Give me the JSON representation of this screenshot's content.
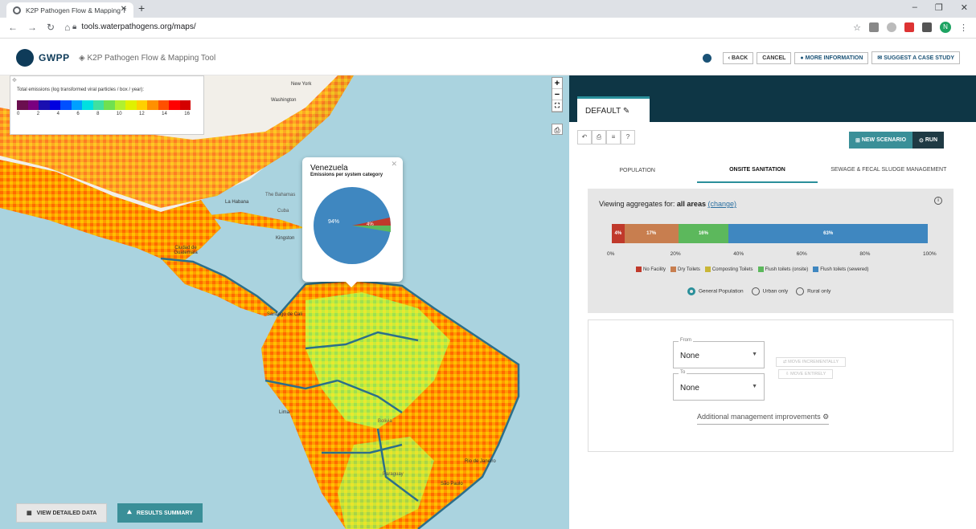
{
  "browser": {
    "tab_title": "K2P Pathogen Flow & Mapping T",
    "url": "tools.waterpathogens.org/maps/",
    "profile_initial": "N"
  },
  "header": {
    "logo_text": "GWPP",
    "app_title": "K2P Pathogen Flow & Mapping Tool",
    "buttons": {
      "back": "BACK",
      "cancel": "CANCEL",
      "more_info": "MORE INFORMATION",
      "suggest": "SUGGEST A CASE STUDY"
    }
  },
  "map": {
    "legend_title": "Total emissions (log transformed viral particles / box / year):",
    "legend_ticks": [
      "0",
      "2",
      "4",
      "6",
      "8",
      "10",
      "12",
      "14",
      "16"
    ],
    "legend_colors": [
      "#6b0f4f",
      "#7a0080",
      "#1a0fb0",
      "#0000e0",
      "#0050ff",
      "#00a0ff",
      "#00e0e0",
      "#40e0a0",
      "#70e050",
      "#b0f030",
      "#e0f000",
      "#ffd000",
      "#ff9000",
      "#ff5000",
      "#ff0000",
      "#d40000"
    ],
    "place_labels": [
      "New York",
      "Washington",
      "The Bahamas",
      "La Habana",
      "Cuba",
      "Kingston",
      "Ciudad de Guatemala",
      "Santiago de Cali",
      "Lima",
      "Bolivia",
      "Paraguay",
      "Rio de Janeiro",
      "São Paulo"
    ],
    "popup": {
      "title": "Venezuela",
      "subtitle": "Emissions per system category",
      "main_label": "94%",
      "small_label": "4%"
    },
    "buttons": {
      "view_data": "VIEW DETAILED DATA",
      "results": "RESULTS SUMMARY"
    }
  },
  "panel": {
    "tab_label": "DEFAULT",
    "new_scenario": "NEW SCENARIO",
    "run": "RUN",
    "tabs": [
      "POPULATION",
      "ONSITE SANITATION",
      "SEWAGE & FECAL SLUDGE MANAGEMENT"
    ],
    "viewing_prefix": "Viewing aggregates for:",
    "viewing_area": "all areas",
    "change_link": "(change)",
    "axis_ticks": [
      "0%",
      "20%",
      "40%",
      "60%",
      "80%",
      "100%"
    ],
    "categories": [
      {
        "name": "No Facility",
        "color": "#c0392b",
        "pct": 4,
        "label": "4%"
      },
      {
        "name": "Dry Toilets",
        "color": "#c87e4f",
        "pct": 17,
        "label": "17%"
      },
      {
        "name": "Composting Toilets",
        "color": "#c9b637",
        "pct": 0,
        "label": ""
      },
      {
        "name": "Flush toilets (onsite)",
        "color": "#5cb85c",
        "pct": 16,
        "label": "16%"
      },
      {
        "name": "Flush toilets (sewered)",
        "color": "#3f87c0",
        "pct": 63,
        "label": "63%"
      }
    ],
    "radios": [
      "General Population",
      "Urban only",
      "Rural only"
    ],
    "from_label": "From",
    "from_value": "None",
    "to_label": "To",
    "to_value": "None",
    "move_incrementally": "MOVE INCREMENTALLY",
    "move_entirely": "MOVE ENTIRELY",
    "additional": "Additional management improvements"
  }
}
